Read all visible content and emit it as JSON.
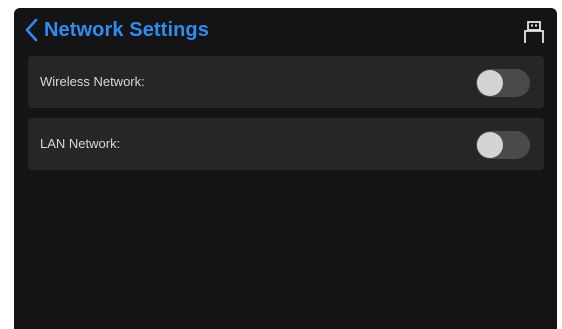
{
  "header": {
    "title": "Network Settings",
    "back_icon": "chevron-left-icon",
    "status_icon": "usb-icon"
  },
  "settings": [
    {
      "label": "Wireless Network:",
      "enabled": false
    },
    {
      "label": "LAN Network:",
      "enabled": false
    }
  ],
  "colors": {
    "accent": "#2f8cf0",
    "background": "#141414",
    "row": "#262626",
    "toggle_off_track": "#4a4a4a",
    "toggle_knob": "#d4d4d4"
  }
}
